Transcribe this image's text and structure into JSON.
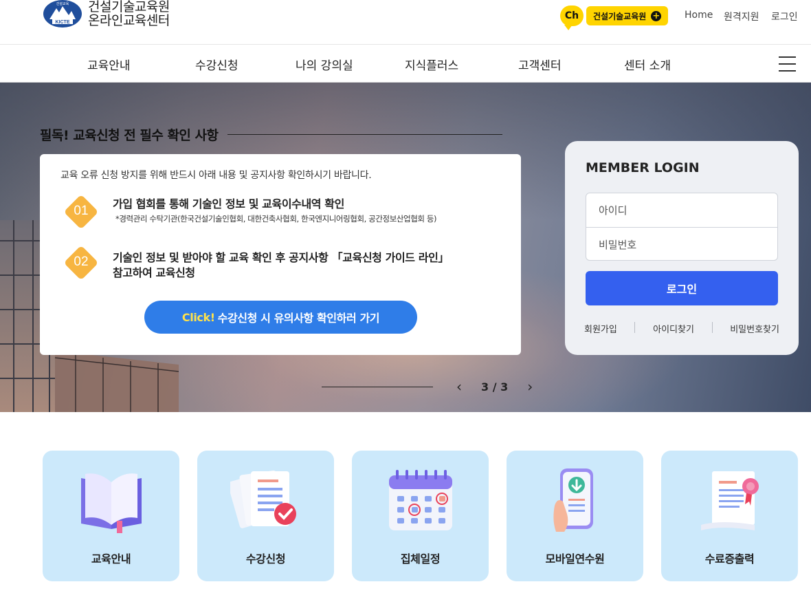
{
  "header": {
    "logo_line1": "건설기술교육원",
    "logo_line2": "온라인교육센터",
    "logo_emblem_text": "KICTE",
    "logo_emblem_top": "건설교육",
    "channel_badge": "Ch",
    "channel_label": "건설기술교육원",
    "util_links": [
      "Home",
      "원격지원",
      "로그인"
    ]
  },
  "nav": {
    "items": [
      "교육안내",
      "수강신청",
      "나의 강의실",
      "지식플러스",
      "고객센터",
      "센터 소개"
    ]
  },
  "hero": {
    "notice_title": "필독! 교육신청 전 필수 확인 사항",
    "notice_intro": "교육 오류 신청 방지를 위해 반드시 아래 내용 및 공지사항 확인하시기 바랍니다.",
    "steps": [
      {
        "num": "01",
        "title": "가입 협회를 통해 기술인 정보 및 교육이수내역 확인",
        "sub": "*경력관리 수탁기관(한국건설기술인협회, 대한건축사협회, 한국엔지니어링협회, 공간정보산업협회 등)"
      },
      {
        "num": "02",
        "title_line1": "기술인 정보 및 받아야 할 교육 확인 후 공지사항 「교육신청 가이드 라인」",
        "title_line2": "참고하여 교육신청"
      }
    ],
    "cta_highlight": "Click!",
    "cta_text": "수강신청 시 유의사항 확인하러 가기",
    "pager": {
      "prev": "‹",
      "next": "›",
      "count": "3 / 3"
    }
  },
  "login": {
    "title": "MEMBER LOGIN",
    "id_placeholder": "아이디",
    "pw_placeholder": "비밀번호",
    "button": "로그인",
    "links": [
      "회원가입",
      "아이디찾기",
      "비밀번호찾기"
    ]
  },
  "quick_menu": [
    {
      "label": "교육안내",
      "icon": "book-icon"
    },
    {
      "label": "수강신청",
      "icon": "application-document-icon"
    },
    {
      "label": "집체일정",
      "icon": "calendar-icon"
    },
    {
      "label": "모바일연수원",
      "icon": "mobile-download-icon"
    },
    {
      "label": "수료증출력",
      "icon": "certificate-icon"
    }
  ],
  "colors": {
    "accent_blue": "#3460ef",
    "cta_blue": "#2f7de8",
    "step_orange": "#f7b541",
    "channel_yellow": "#ffd400",
    "quick_bg": "#cce9fb"
  }
}
